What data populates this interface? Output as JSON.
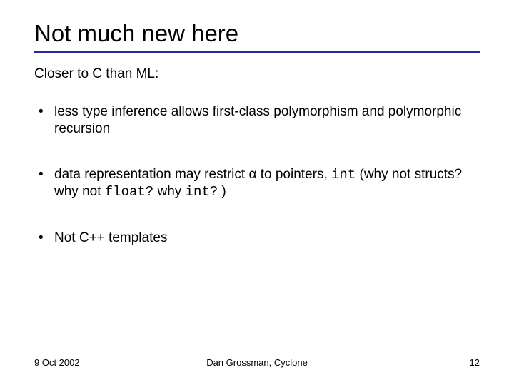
{
  "title": "Not much new here",
  "subhead": "Closer to C than ML:",
  "bullets": [
    {
      "pre": "less type inference allows first-class polymorphism and polymorphic recursion"
    },
    {
      "pre": "data representation may restrict α to pointers, ",
      "code1": "int",
      "mid": " (why not structs? why not ",
      "code2": "float?",
      "mid2": " why ",
      "code3": "int?",
      "post": " )"
    },
    {
      "pre": "Not C++ templates"
    }
  ],
  "footer": {
    "date": "9 Oct 2002",
    "author": "Dan Grossman, Cyclone",
    "page": "12"
  }
}
